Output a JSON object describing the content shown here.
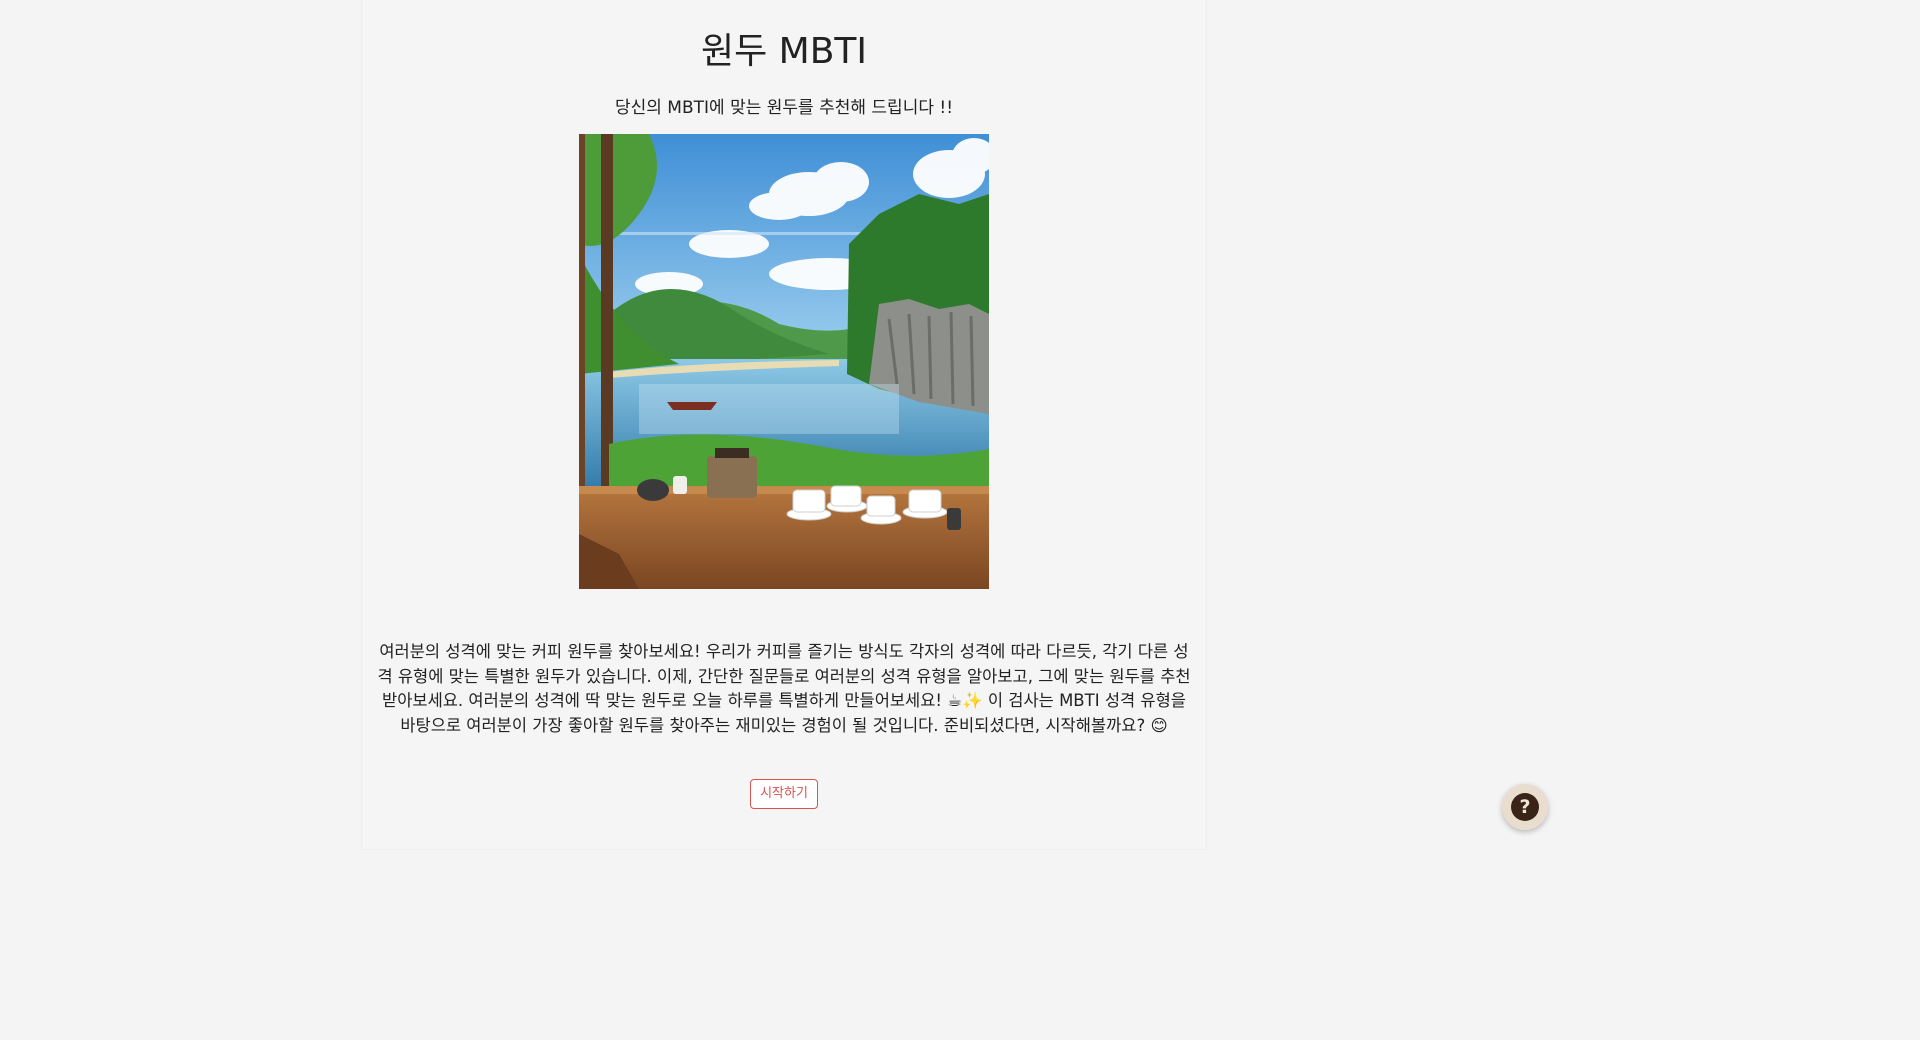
{
  "header": {
    "title": "원두 MBTI",
    "subtitle": "당신의 MBTI에 맞는 원두를 추천해 드립니다 !!"
  },
  "hero_image": {
    "alt": "호숫가 카페 창가의 커피잔 일러스트"
  },
  "main": {
    "description": "여러분의 성격에 맞는 커피 원두를 찾아보세요! 우리가 커피를 즐기는 방식도 각자의 성격에 따라 다르듯, 각기 다른 성격 유형에 맞는 특별한 원두가 있습니다. 이제, 간단한 질문들로 여러분의 성격 유형을 알아보고, 그에 맞는 원두를 추천받아보세요. 여러분의 성격에 딱 맞는 원두로 오늘 하루를 특별하게 만들어보세요! ☕✨ 이 검사는 MBTI 성격 유형을 바탕으로 여러분이 가장 좋아할 원두를 찾아주는 재미있는 경험이 될 것입니다. 준비되셨다면, 시작해볼까요? 😊",
    "start_label": "시작하기"
  },
  "help": {
    "icon": "help-question-icon",
    "glyph": "?"
  },
  "colors": {
    "accent": "#d9534f",
    "background": "#f4f4f4",
    "text": "#222222",
    "help_bg": "#e9ddd0",
    "help_icon": "#3a2418"
  }
}
